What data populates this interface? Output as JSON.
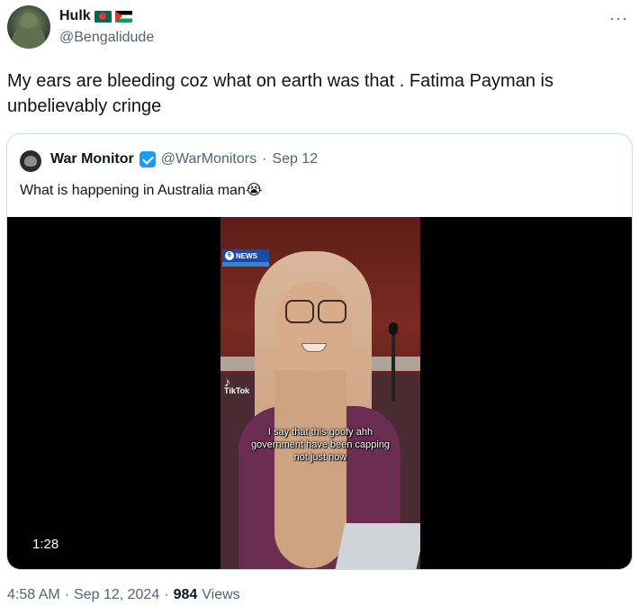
{
  "author": {
    "name": "Hulk",
    "flags": [
      "bangladesh-flag",
      "palestine-flag"
    ],
    "handle": "@Bengalidude"
  },
  "more_icon": "···",
  "tweet": {
    "text": "My ears are bleeding coz what on earth was that . Fatima Payman is unbelievably cringe"
  },
  "quote": {
    "name": "War Monitor",
    "verified": true,
    "handle": "@WarMonitors",
    "separator": "·",
    "date": "Sep 12",
    "text": "What is happening in Australia man😭",
    "video": {
      "news_logo": "NEWS",
      "news_six": "6",
      "tiktok_label": "TikTok",
      "tiktok_note": "♪",
      "caption": "I say that this goofy ahh government have been capping not just now",
      "duration": "1:28"
    }
  },
  "meta": {
    "time": "4:58 AM",
    "sep1": "·",
    "date": "Sep 12, 2024",
    "sep2": "·",
    "views_count": "984",
    "views_label": "Views"
  },
  "colors": {
    "text": "#0f1419",
    "secondary": "#536471",
    "border": "#cfd9de",
    "verified": "#1d9bf0"
  }
}
